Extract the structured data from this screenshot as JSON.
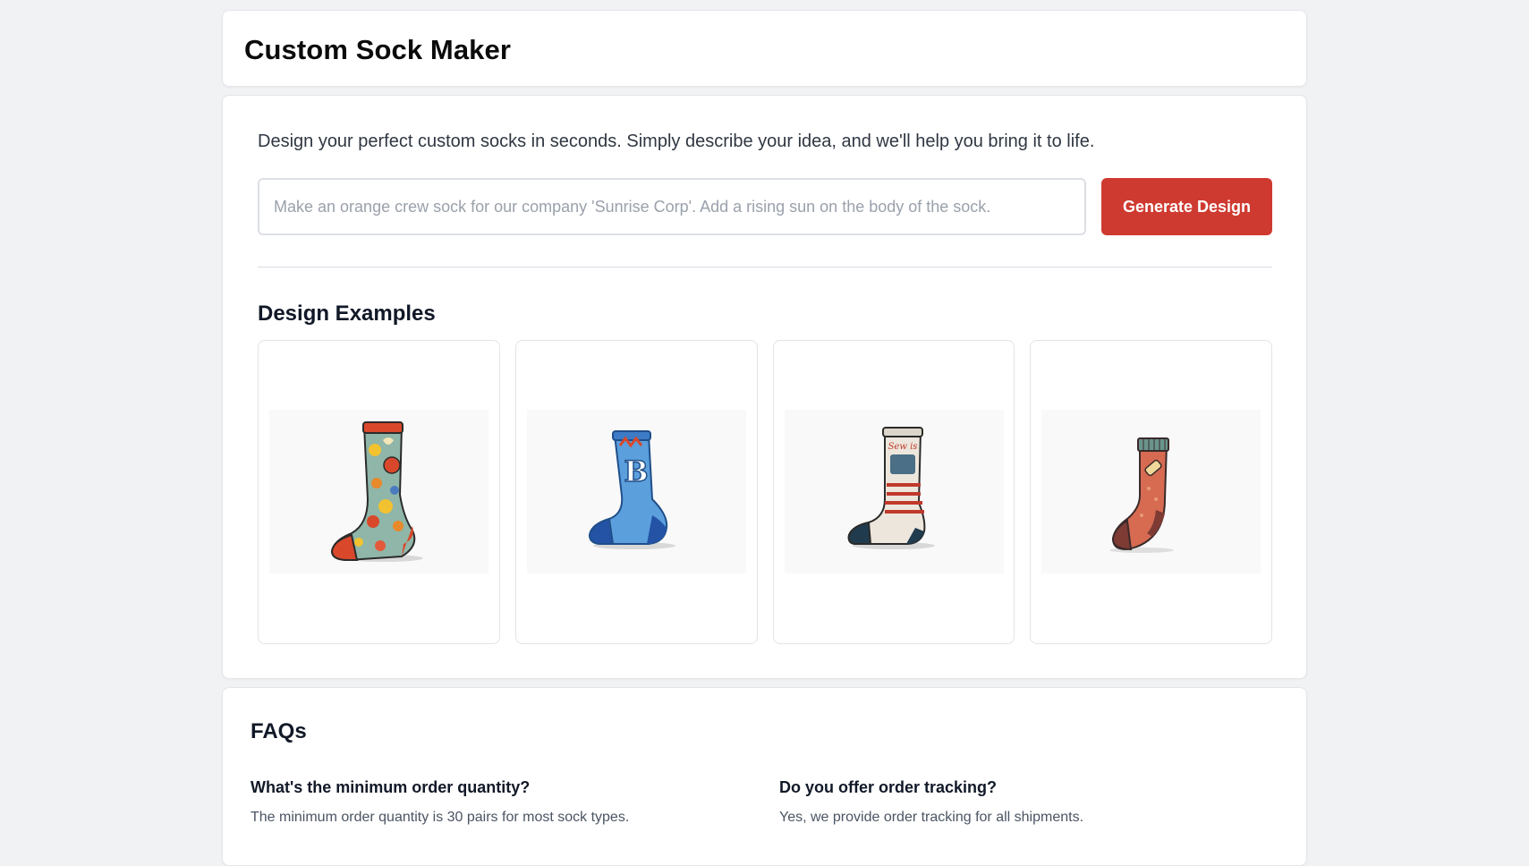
{
  "header": {
    "title": "Custom Sock Maker"
  },
  "designer": {
    "intro": "Design your perfect custom socks in seconds. Simply describe your idea, and we'll help you bring it to life.",
    "prompt_placeholder": "Make an orange crew sock for our company 'Sunrise Corp'. Add a rising sun on the body of the sock.",
    "prompt_value": "",
    "generate_label": "Generate Design",
    "accent_color": "#cf3a30"
  },
  "examples": {
    "title": "Design Examples",
    "items": [
      {
        "icon": "fruit-pattern-sock-icon"
      },
      {
        "icon": "blue-letter-b-sock-icon",
        "text": "B"
      },
      {
        "icon": "sewing-machine-striped-sock-icon",
        "text": "Sew is"
      },
      {
        "icon": "orange-bandage-sock-icon"
      }
    ]
  },
  "faqs": {
    "title": "FAQs",
    "items": [
      {
        "question": "What's the minimum order quantity?",
        "answer": "The minimum order quantity is 30 pairs for most sock types."
      },
      {
        "question": "Do you offer order tracking?",
        "answer": "Yes, we provide order tracking for all shipments."
      }
    ]
  }
}
